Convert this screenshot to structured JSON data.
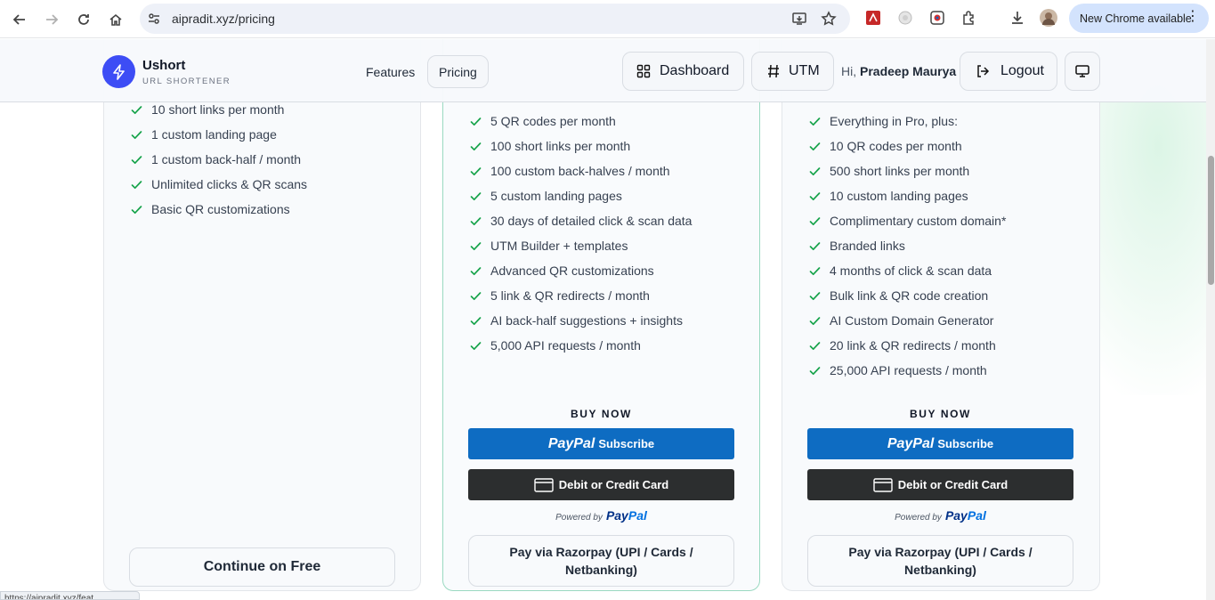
{
  "browser": {
    "url": "aipradit.xyz/pricing",
    "update_pill": "New Chrome available",
    "menu_dots": "⋮"
  },
  "header": {
    "brand_name": "Ushort",
    "brand_sub": "URL SHORTENER",
    "nav": {
      "features": "Features",
      "pricing": "Pricing"
    },
    "dashboard": "Dashboard",
    "utm": "UTM",
    "greeting_prefix": "Hi,",
    "user_name": "Pradeep Maurya",
    "logout": "Logout"
  },
  "plans": {
    "free": {
      "features": [
        "10 short links per month",
        "1 custom landing page",
        "1 custom back-half / month",
        "Unlimited clicks & QR scans",
        "Basic QR customizations"
      ],
      "cta": "Continue on Free"
    },
    "pro": {
      "features": [
        "5 QR codes per month",
        "100 short links per month",
        "100 custom back-halves / month",
        "5 custom landing pages",
        "30 days of detailed click & scan data",
        "UTM Builder + templates",
        "Advanced QR customizations",
        "5 link & QR redirects / month",
        "AI back-half suggestions + insights",
        "5,000 API requests / month"
      ],
      "buy_now": "BUY NOW",
      "paypal_logo": "PayPal",
      "paypal_subscribe": "Subscribe",
      "card_button": "Debit or Credit Card",
      "powered_by": "Powered by",
      "powered_logo_a": "Pay",
      "powered_logo_b": "Pal",
      "razorpay": "Pay via Razorpay (UPI / Cards / Netbanking)"
    },
    "business": {
      "features": [
        "Everything in Pro, plus:",
        "10 QR codes per month",
        "500 short links per month",
        "10 custom landing pages",
        "Complimentary custom domain*",
        "Branded links",
        "4 months of click & scan data",
        "Bulk link & QR code creation",
        "AI Custom Domain Generator",
        "20 link & QR redirects / month",
        "25,000 API requests / month"
      ],
      "buy_now": "BUY NOW",
      "paypal_logo": "PayPal",
      "paypal_subscribe": "Subscribe",
      "card_button": "Debit or Credit Card",
      "powered_by": "Powered by",
      "powered_logo_a": "Pay",
      "powered_logo_b": "Pal",
      "razorpay": "Pay via Razorpay (UPI / Cards / Netbanking)"
    }
  },
  "status_bar": "https://aipradit.xyz/feat...",
  "colors": {
    "check": "#16a34a",
    "paypal_blue": "#0e6cc2",
    "card_dark": "#2c2e2f",
    "brand_accent": "#3d4df5"
  }
}
